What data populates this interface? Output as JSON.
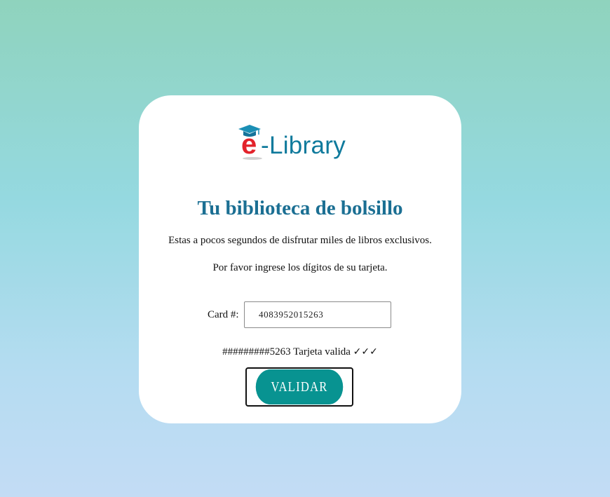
{
  "brand": {
    "logo_e": "e",
    "logo_text": "-Library",
    "accent_red": "#e3232b",
    "accent_blue": "#0f7a9c",
    "cap_icon": "graduation-cap-icon"
  },
  "main": {
    "title": "Tu biblioteca de bolsillo",
    "paragraph1": "Estas a pocos segundos de disfrutar miles de libros exclusivos.",
    "paragraph2": "Por favor ingrese los dígitos de su tarjeta."
  },
  "form": {
    "card_label": "Card #:",
    "card_value": "4083952015263",
    "validation_text": "#########5263 Tarjeta valida",
    "validation_checks": "✓✓✓",
    "submit_label": "VALIDAR",
    "button_color": "#089391"
  }
}
